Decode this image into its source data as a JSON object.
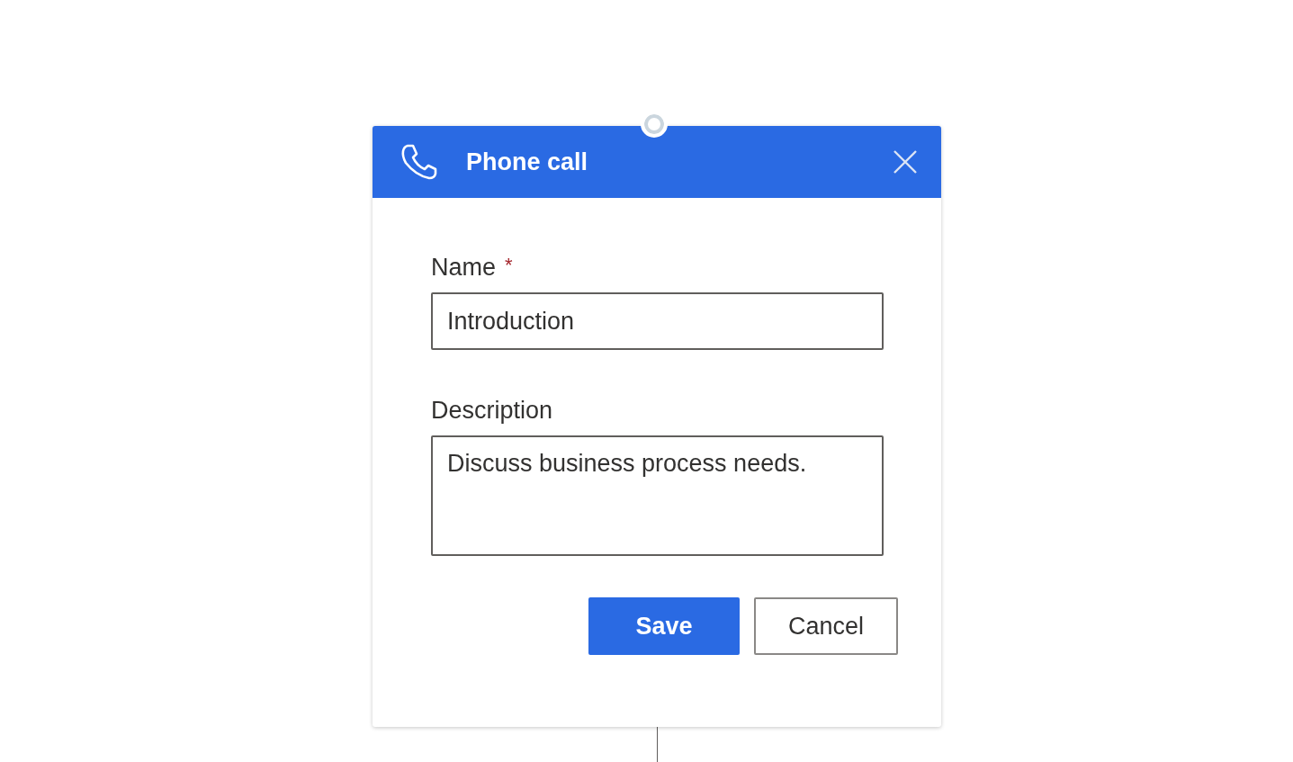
{
  "dialog": {
    "title": "Phone call"
  },
  "fields": [
    {
      "label": "Name",
      "required_mark": "*",
      "kind": "input",
      "value": "Introduction"
    },
    {
      "label": "Description",
      "kind": "textarea",
      "value": "Discuss business process needs."
    }
  ],
  "buttons": [
    {
      "label": "Save",
      "kind": "primary"
    },
    {
      "label": "Cancel",
      "kind": "secondary"
    }
  ]
}
